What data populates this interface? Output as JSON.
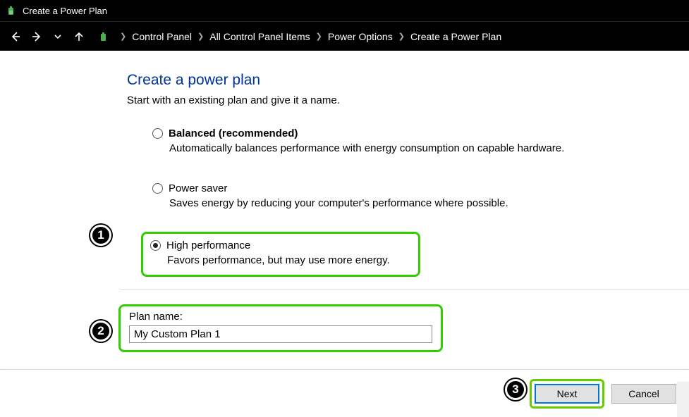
{
  "window": {
    "title": "Create a Power Plan"
  },
  "breadcrumb": {
    "root": "Control Panel",
    "items1": "All Control Panel Items",
    "items2": "Power Options",
    "items3": "Create a Power Plan"
  },
  "page": {
    "title": "Create a power plan",
    "subtitle": "Start with an existing plan and give it a name."
  },
  "options": {
    "balanced": {
      "label": "Balanced (recommended)",
      "desc": "Automatically balances performance with energy consumption on capable hardware."
    },
    "saver": {
      "label": "Power saver",
      "desc": "Saves energy by reducing your computer's performance where possible."
    },
    "high": {
      "label": "High performance",
      "desc": "Favors performance, but may use more energy."
    }
  },
  "plan": {
    "label": "Plan name:",
    "value": "My Custom Plan 1"
  },
  "buttons": {
    "next": "Next",
    "cancel": "Cancel"
  },
  "steps": {
    "s1": "1",
    "s2": "2",
    "s3": "3"
  }
}
